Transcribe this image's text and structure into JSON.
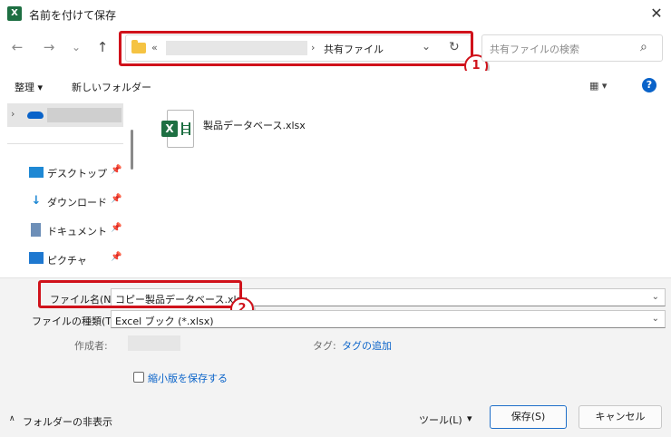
{
  "window": {
    "app_icon_glyph": "X",
    "title": "名前を付けて保存",
    "close_glyph": "✕"
  },
  "nav": {
    "back_glyph": "←",
    "forward_glyph": "→",
    "recent_glyph": "⌄",
    "up_glyph": "↑"
  },
  "address": {
    "overflow_glyph": "«",
    "separator_glyph": "›",
    "current_folder": "共有ファイル",
    "dropdown_glyph": "⌄",
    "refresh_glyph": "↻"
  },
  "search": {
    "placeholder": "共有ファイルの検索",
    "icon_glyph": "⌕"
  },
  "toolbar": {
    "organize_label": "整理 ▾",
    "new_folder_label": "新しいフォルダー",
    "view_glyph": "▦ ▾",
    "help_glyph": "?"
  },
  "sidebar": {
    "expand_glyph": "›",
    "items": [
      {
        "label": "デスクトップ",
        "icon": "desktop-icon",
        "pin": "📌"
      },
      {
        "label": "ダウンロード",
        "icon": "download-icon",
        "pin": "📌"
      },
      {
        "label": "ドキュメント",
        "icon": "document-icon",
        "pin": "📌"
      },
      {
        "label": "ピクチャ",
        "icon": "pictures-icon",
        "pin": "📌"
      }
    ]
  },
  "files": [
    {
      "name": "製品データベース.xlsx",
      "icon": "excel-file-icon",
      "icon_glyph": "X"
    }
  ],
  "form": {
    "filename_label": "ファイル名(N):",
    "filename_value": "コピー製品データベース.xlsx",
    "filetype_label": "ファイルの種類(T):",
    "filetype_value": "Excel ブック (*.xlsx)",
    "author_label": "作成者:",
    "tags_label": "タグ:",
    "tags_link": "タグの追加",
    "thumbnail_label": "縮小版を保存する",
    "chevron_glyph": "⌄"
  },
  "footer": {
    "hide_folders_label": "フォルダーの非表示",
    "hide_glyph": "∧",
    "tools_label": "ツール(L)",
    "tools_glyph": "▾",
    "save_label": "保存(S)",
    "cancel_label": "キャンセル"
  },
  "callouts": {
    "one": "1",
    "two": "2"
  },
  "colors": {
    "highlight": "#d0121b",
    "accent": "#0a63c9",
    "excel_green": "#1d6f42"
  }
}
